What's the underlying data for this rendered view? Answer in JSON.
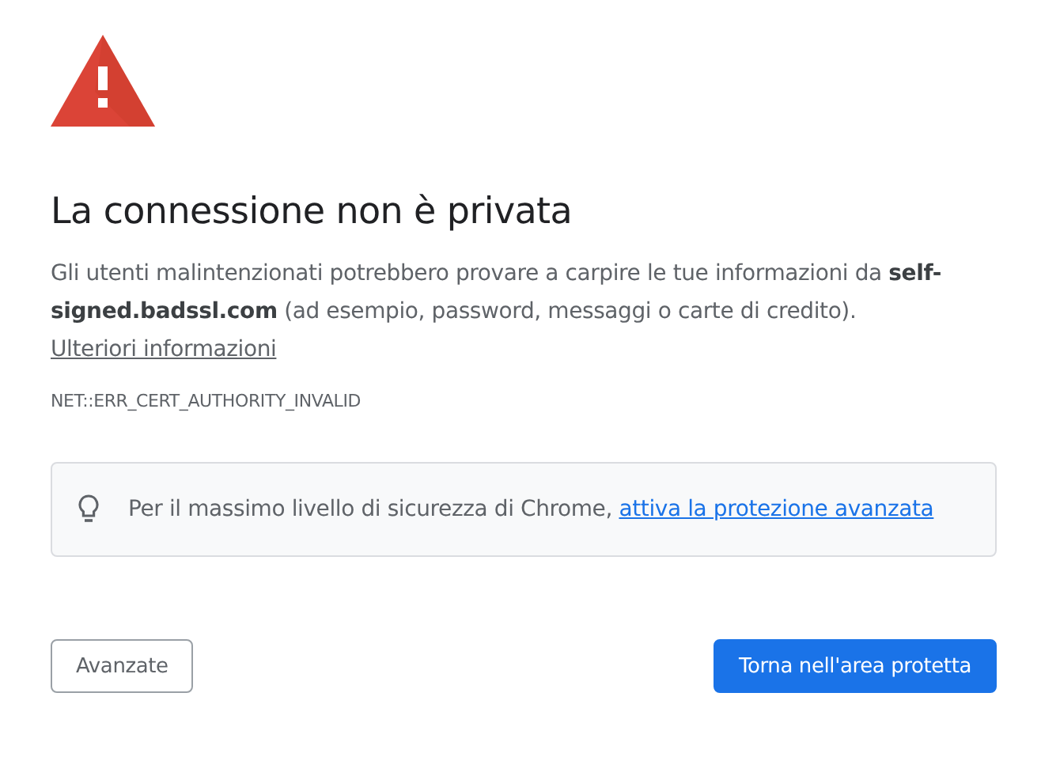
{
  "heading": "La connessione non è privata",
  "description": {
    "text": "Gli utenti malintenzionati potrebbero provare a carpire le tue informazioni da **self-signed.badssl.com** (ad esempio, password, messaggi o carte di credito).",
    "link": "Ulteriori informazioni"
  },
  "error_code": "NET::ERR_CERT_AUTHORITY_INVALID",
  "tip": {
    "text": "Per il massimo livello di sicurezza di Chrome,",
    "link": "attiva la protezione avanzata"
  },
  "buttons": [
    {
      "label": "Avanzate",
      "kind": "secondary"
    },
    {
      "label": "Torna nell'area protetta",
      "kind": "primary"
    }
  ]
}
